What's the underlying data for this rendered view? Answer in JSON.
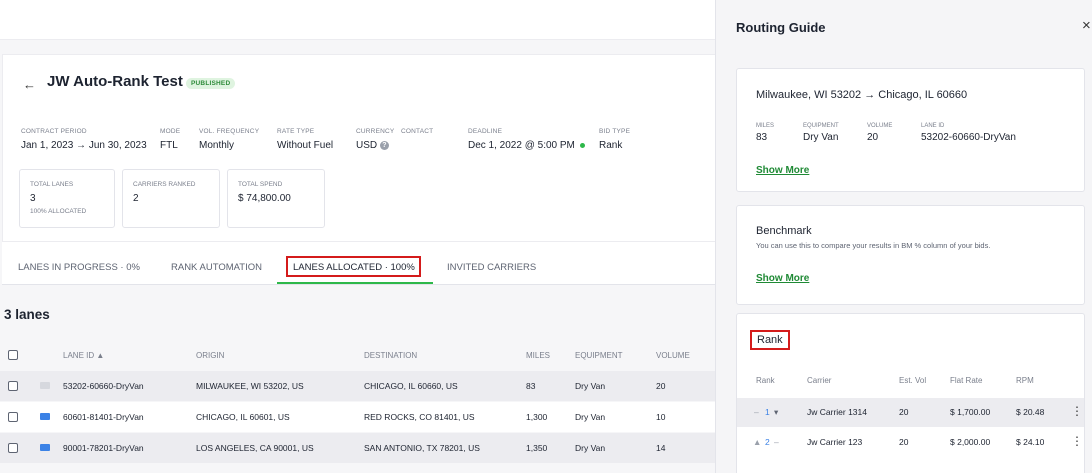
{
  "contract": {
    "back_glyph": "←",
    "title": "JW Auto-Rank Test",
    "status": "PUBLISHED",
    "fields": [
      {
        "label": "CONTRACT PERIOD",
        "value": "Jan 1, 2023 → Jun 30, 2023"
      },
      {
        "label": "MODE",
        "value": "FTL"
      },
      {
        "label": "VOL. FREQUENCY",
        "value": "Monthly"
      },
      {
        "label": "RATE TYPE",
        "value": "Without Fuel"
      },
      {
        "label": "CURRENCY",
        "value": "USD"
      },
      {
        "label": "CONTACT",
        "value": ""
      },
      {
        "label": "DEADLINE",
        "value": "Dec 1, 2022 @ 5:00 PM"
      },
      {
        "label": "BID TYPE",
        "value": "Rank"
      }
    ],
    "stats": [
      {
        "label": "TOTAL LANES",
        "value": "3",
        "sub": "100% ALLOCATED"
      },
      {
        "label": "CARRIERS RANKED",
        "value": "2",
        "sub": ""
      },
      {
        "label": "TOTAL SPEND",
        "value": "$ 74,800.00",
        "sub": ""
      }
    ]
  },
  "tabs": [
    {
      "label": "LANES IN PROGRESS · 0%",
      "active": false
    },
    {
      "label": "RANK AUTOMATION",
      "active": false
    },
    {
      "label": "LANES ALLOCATED · 100%",
      "active": true
    },
    {
      "label": "INVITED CARRIERS",
      "active": false
    }
  ],
  "lanes": {
    "title": "3 lanes",
    "columns": [
      "LANE ID ▲",
      "ORIGIN",
      "DESTINATION",
      "MILES",
      "EQUIPMENT",
      "VOLUME"
    ],
    "rows": [
      {
        "lane_id": "53202-60660-DryVan",
        "origin": "MILWAUKEE, WI 53202, US",
        "destination": "CHICAGO, IL 60660, US",
        "miles": "83",
        "equipment": "Dry Van",
        "volume": "20",
        "mail_color": "#d6d8de"
      },
      {
        "lane_id": "60601-81401-DryVan",
        "origin": "CHICAGO, IL 60601, US",
        "destination": "RED ROCKS, CO 81401, US",
        "miles": "1,300",
        "equipment": "Dry Van",
        "volume": "10",
        "mail_color": "#3b82e6"
      },
      {
        "lane_id": "90001-78201-DryVan",
        "origin": "LOS ANGELES, CA 90001, US",
        "destination": "SAN ANTONIO, TX 78201, US",
        "miles": "1,350",
        "equipment": "Dry Van",
        "volume": "14",
        "mail_color": "#3b82e6"
      }
    ]
  },
  "routing_guide": {
    "title": "Routing Guide",
    "close_glyph": "×",
    "route": "Milwaukee, WI 53202 → Chicago, IL 60660",
    "meta": [
      {
        "label": "MILES",
        "value": "83"
      },
      {
        "label": "EQUIPMENT",
        "value": "Dry Van"
      },
      {
        "label": "VOLUME",
        "value": "20"
      },
      {
        "label": "LANE ID",
        "value": "53202-60660-DryVan"
      }
    ],
    "show_more": "Show More",
    "benchmark": {
      "title": "Benchmark",
      "description": "You can use this to compare your results in BM % column of your bids.",
      "show_more": "Show More"
    },
    "rank": {
      "title": "Rank",
      "columns": [
        "Rank",
        "Carrier",
        "Est. Vol",
        "Flat Rate",
        "RPM"
      ],
      "rows": [
        {
          "rank": "1",
          "up": "–",
          "carrier": "Jw Carrier 1314",
          "est_vol": "20",
          "flat_rate": "$ 1,700.00",
          "rpm": "$ 20.48"
        },
        {
          "rank": "2",
          "up": "▲",
          "carrier": "Jw Carrier 123",
          "est_vol": "20",
          "flat_rate": "$ 2,000.00",
          "rpm": "$ 24.10"
        }
      ]
    }
  },
  "colors": {
    "accent_green": "#2eb84a",
    "highlight_red": "#d41b1b",
    "mail_blue": "#3b82e6"
  }
}
